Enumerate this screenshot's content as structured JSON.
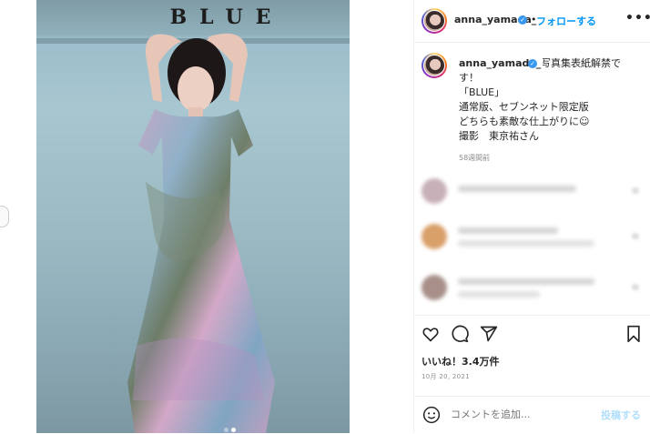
{
  "post": {
    "magazine_title": "BLUE",
    "carousel": {
      "count": 2,
      "active_index": 1
    }
  },
  "header": {
    "username": "anna_yamada_",
    "separator": "•",
    "follow_label": "フォローする",
    "more_label": "•••"
  },
  "caption": {
    "username": "anna_yamada_",
    "lines": [
      "写真集表紙解禁で",
      "す！",
      "「BLUE」",
      "通常版、セブンネット限定版",
      "どちらも素敵な仕上がりに☺",
      "",
      "撮影　東京祐さん"
    ],
    "time_ago": "58週間前"
  },
  "engagement": {
    "likes": "いいね！3.4万件",
    "date": "10月 20, 2021"
  },
  "comment_input": {
    "placeholder": "コメントを追加...",
    "post_label": "投稿する"
  },
  "icons": [
    "heart-icon",
    "comment-icon",
    "share-icon",
    "bookmark-icon",
    "emoji-icon",
    "verified-badge-icon",
    "more-options-icon"
  ],
  "colors": {
    "accent": "#0095f6",
    "post_disabled": "#b2dffc",
    "muted": "#8e8e8e"
  }
}
